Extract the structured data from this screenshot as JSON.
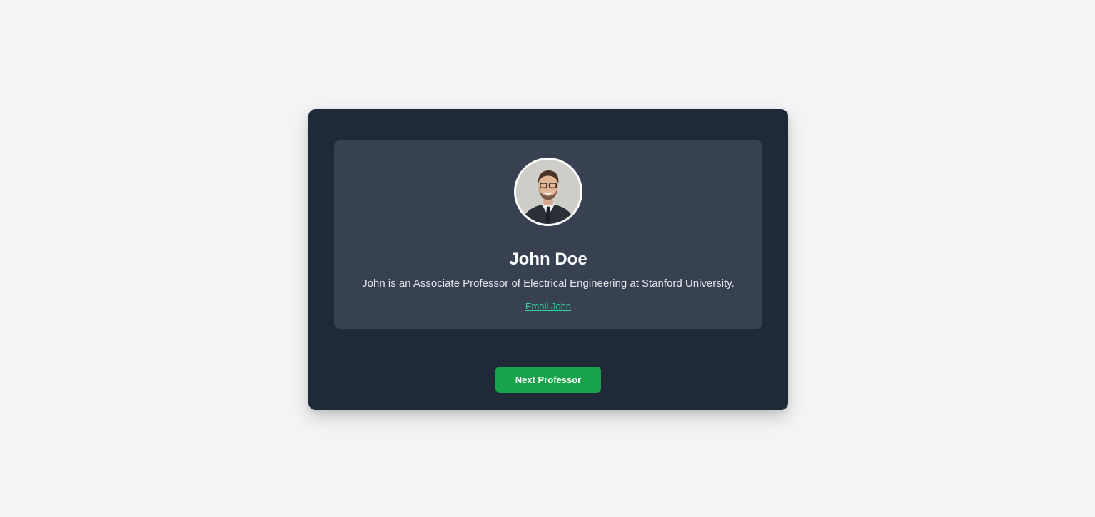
{
  "professor": {
    "name": "John Doe",
    "bio": "John is an Associate Professor of Electrical Engineering at Stanford University.",
    "email_label": "Email John",
    "avatar_icon": "professor-photo"
  },
  "actions": {
    "next_label": "Next Professor"
  },
  "colors": {
    "page_background": "#f3f4f6",
    "card_background": "#1f2937",
    "panel_background": "#374151",
    "link": "#34d399",
    "button": "#16a34a"
  }
}
